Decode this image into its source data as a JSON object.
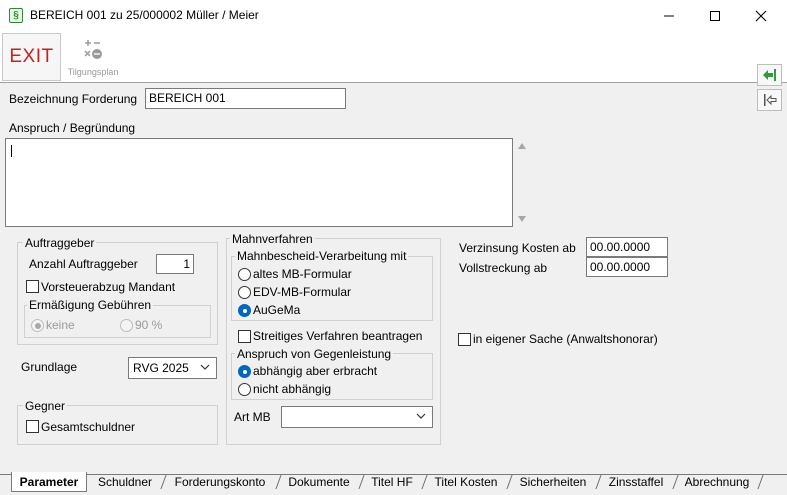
{
  "window": {
    "title": "BEREICH 001 zu 25/000002 Müller / Meier",
    "app_icon_glyph": "§"
  },
  "toolbar": {
    "exit_label": "EXIT",
    "tilgungsplan_label": "Tilgungsplan",
    "nav_forward_icon": "green-arrow-left-icon",
    "nav_back_icon": "arrow-left-bar-icon"
  },
  "form": {
    "bezeichnung_label": "Bezeichnung Forderung",
    "bezeichnung_value": "BEREICH 001",
    "anspruch_label": "Anspruch / Begründung",
    "anspruch_value": ""
  },
  "auftraggeber": {
    "title": "Auftraggeber",
    "anzahl_label": "Anzahl Auftraggeber",
    "anzahl_value": "1",
    "vorsteuer_label": "Vorsteuerabzug Mandant",
    "vorsteuer_checked": false,
    "ermaessigung_title": "Ermäßigung Gebühren",
    "options": [
      "keine",
      "90 %"
    ],
    "selected": "keine"
  },
  "grundlage": {
    "label": "Grundlage",
    "value": "RVG 2025"
  },
  "gegner": {
    "title": "Gegner",
    "gesamtschuldner_label": "Gesamtschuldner",
    "gesamtschuldner_checked": false
  },
  "mahnverfahren": {
    "title": "Mahnverfahren",
    "verarbeitung_title": "Mahnbescheid-Verarbeitung mit",
    "options": [
      "altes MB-Formular",
      "EDV-MB-Formular",
      "AuGeMa"
    ],
    "selected": "AuGeMa",
    "streitig_label": "Streitiges Verfahren beantragen",
    "streitig_checked": false,
    "gegenleistung_title": "Anspruch von Gegenleistung",
    "gegenleistung_options": [
      "abhängig aber erbracht",
      "nicht abhängig"
    ],
    "gegenleistung_selected": "abhängig aber erbracht",
    "art_mb_label": "Art MB",
    "art_mb_value": ""
  },
  "right": {
    "verzinsung_label": "Verzinsung Kosten ab",
    "verzinsung_value": "00.00.0000",
    "vollstreckung_label": "Vollstreckung ab",
    "vollstreckung_value": "00.00.0000",
    "eigene_sache_label": "in eigener Sache (Anwaltshonorar)",
    "eigene_sache_checked": false
  },
  "tabs": [
    {
      "label": "Parameter",
      "active": true
    },
    {
      "label": "Schuldner"
    },
    {
      "label": "Forderungskonto"
    },
    {
      "label": "Dokumente"
    },
    {
      "label": "Titel HF"
    },
    {
      "label": "Titel Kosten"
    },
    {
      "label": "Sicherheiten"
    },
    {
      "label": "Zinsstaffel"
    },
    {
      "label": "Abrechnung"
    }
  ],
  "colors": {
    "exit_red": "#cc1f1f",
    "radio_blue": "#0067c0",
    "nav_green": "#2e9b3e"
  }
}
